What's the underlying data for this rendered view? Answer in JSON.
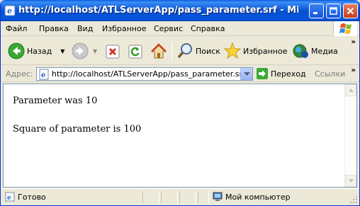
{
  "window": {
    "title": "http://localhost/ATLServerApp/pass_parameter.srf - Microsoft Internet Explorer",
    "controls": {
      "minimize": "minimize",
      "maximize": "maximize",
      "close": "close"
    }
  },
  "menu": {
    "items": [
      "Файл",
      "Правка",
      "Вид",
      "Избранное",
      "Сервис",
      "Справка"
    ]
  },
  "toolbar": {
    "back_label": "Назад",
    "search_label": "Поиск",
    "favorites_label": "Избранное",
    "media_label": "Медиа",
    "overflow": "»"
  },
  "address": {
    "label": "Адрес:",
    "url": "http://localhost/ATLServerApp/pass_parameter.srf",
    "go_label": "Переход",
    "links_label": "Ссылки",
    "links_overflow": "»"
  },
  "page": {
    "line1": "Parameter was 10",
    "line2": "Square of parameter is 100"
  },
  "status": {
    "text": "Готово",
    "zone": "Мой компьютер"
  },
  "colors": {
    "titlebar": "#0451d4",
    "chrome": "#ece9d8",
    "close_button": "#c2401e"
  }
}
